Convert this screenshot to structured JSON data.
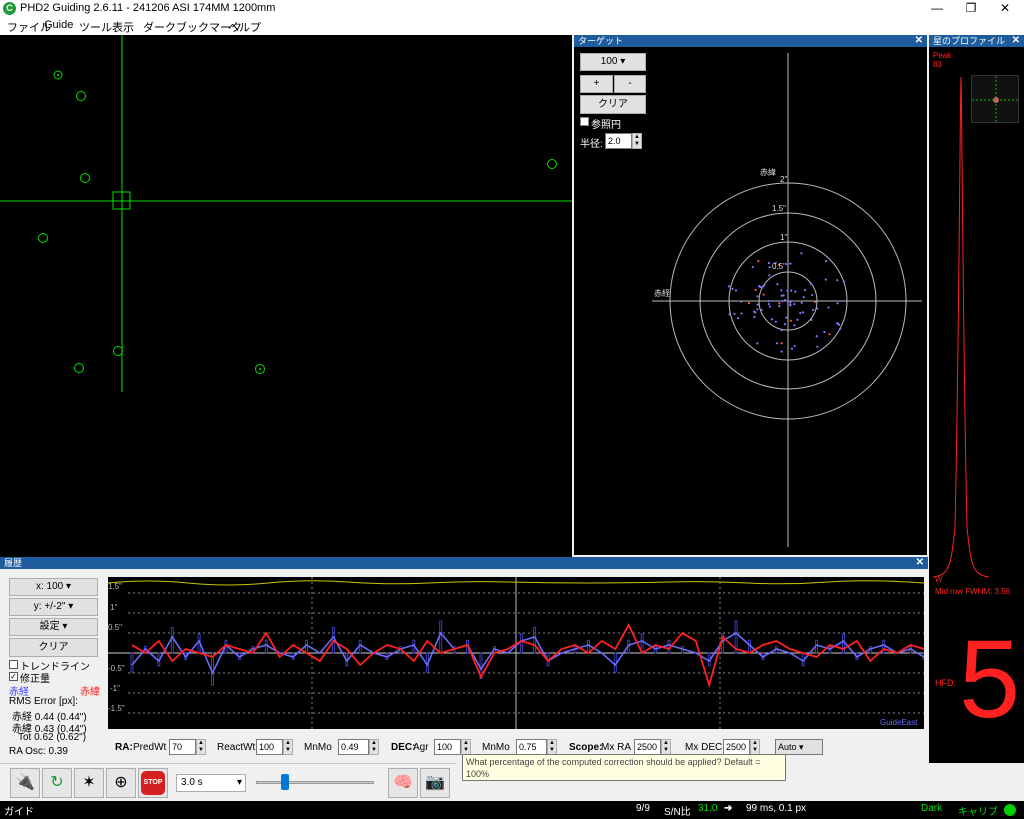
{
  "window": {
    "title": "PHD2 Guiding 2.6.11 - 241206 ASI 174MM  1200mm",
    "icon": "app-logo-icon",
    "buttons": {
      "minimize": "—",
      "maximize": "❐",
      "close": "✕"
    }
  },
  "menu": [
    "ファイル",
    "Guide",
    "ツール",
    "表示",
    "ダーク",
    "ブックマーク",
    "ヘルプ"
  ],
  "target": {
    "title": "ターゲット",
    "close": "✕",
    "zoom": "100",
    "plus": "+",
    "minus": "-",
    "clear": "クリア",
    "ref_circle": "参照円",
    "radius_label": "半径:",
    "radius_value": "2.0",
    "dec_label": "赤緯",
    "ra_label": "赤経",
    "ring_labels": [
      "2\"",
      "1.5\"",
      "1\"",
      "0.5\""
    ]
  },
  "profile": {
    "title": "星のプロファイル",
    "close": "✕",
    "peak_label": "Peak",
    "peak_value": "83",
    "w_label": "W",
    "midrow": "Mid row FWHM: 3.56",
    "hfd_label": "HFD:",
    "hfd_value": "5"
  },
  "history": {
    "title": "履歴",
    "close": "✕",
    "x_scale": "x: 100",
    "y_scale": "y: +/-2\"",
    "settings": "設定",
    "clear": "クリア",
    "trendline": "トレンドライン",
    "corrections": "修正量",
    "corrections_checked": true,
    "trendline_checked": false,
    "ra_legend": "赤経",
    "dec_legend": "赤緯",
    "rms_title": "RMS Error [px]:",
    "rms_ra": "赤経 0.44 (0.44\")",
    "rms_dec": "赤緯 0.43 (0.44\")",
    "rms_tot": "Tot 0.62 (0.62\")",
    "ra_osc": "RA Osc: 0.39",
    "y_ticks": [
      "1.5\"",
      "1\"",
      "0.5\"",
      "-0.5\"",
      "-1\"",
      "-1.5\""
    ],
    "algo_label": "GuideEast"
  },
  "params": {
    "ra_label": "RA:",
    "predwt_label": "PredWt",
    "predwt": "70",
    "reactwt_label": "ReactWt",
    "reactwt": "100",
    "mnmo_label": "MnMo",
    "mnmo_ra": "0.49",
    "dec_label": "DEC:",
    "agr_label": "Agr",
    "agr": "100",
    "mnmo_dec": "0.75",
    "scope_label": "Scope:",
    "mxra_label": "Mx RA",
    "mxra": "2500",
    "mxdec_label": "Mx DEC",
    "mxdec": "2500",
    "mode": "Auto"
  },
  "tooltip": "What percentage of the computed correction should be applied? Default = 100%",
  "toolbar": {
    "exposure": "3.0 s",
    "icons": [
      "usb-plug-icon",
      "loop-icon",
      "auto-select-star-icon",
      "guide-crosshair-icon",
      "stop-icon",
      "brain-icon",
      "camera-settings-icon"
    ],
    "stop_label": "STOP"
  },
  "status": {
    "mode": "ガイド",
    "frames": "9/9",
    "snr_label": "S/N比",
    "snr": "31.0",
    "timing": "99 ms, 0.1 px",
    "dark": "Dark",
    "calib": "キャリブ"
  },
  "colors": {
    "guide_green": "#00e000",
    "ra_blue": "#6a6aff",
    "dec_red": "#ff2020",
    "snr_yellow": "#c8c800",
    "pane_blue": "#1e5c9e"
  },
  "chart_data": {
    "type": "line",
    "ylim": [
      -2,
      2
    ],
    "series": [
      {
        "name": "赤経",
        "values": [
          -0.3,
          0.1,
          -0.2,
          0.4,
          -0.1,
          0.3,
          -0.5,
          0.2,
          -0.1,
          0.1,
          0.2,
          0.0,
          -0.1,
          0.2,
          0.0,
          0.4,
          -0.2,
          0.2,
          0.0,
          -0.1,
          0.1,
          0.2,
          -0.3,
          0.5,
          0.1,
          0.2,
          -0.4,
          0.1,
          0.0,
          0.3,
          0.4,
          -0.2,
          0.0,
          0.1,
          0.2,
          0.0,
          -0.3,
          0.2,
          0.3,
          0.1,
          0.2,
          0.1,
          0.0,
          -0.2,
          0.3,
          0.5,
          0.2,
          -0.1,
          0.1,
          0.0,
          -0.2,
          0.2,
          0.1,
          0.3,
          -0.1,
          0.1,
          0.2,
          0.0,
          0.1,
          -0.1
        ]
      },
      {
        "name": "赤緯",
        "values": [
          0.2,
          0.0,
          0.3,
          -0.2,
          0.1,
          0.0,
          -0.1,
          0.2,
          0.1,
          0.0,
          0.5,
          -0.1,
          0.2,
          0.0,
          -0.2,
          0.3,
          0.1,
          -0.3,
          0.0,
          0.2,
          0.1,
          -0.2,
          0.3,
          0.0,
          0.1,
          0.2,
          -0.6,
          0.0,
          0.1,
          0.3,
          0.2,
          -0.2,
          0.1,
          0.2,
          0.0,
          0.3,
          0.1,
          0.7,
          0.0,
          0.2,
          0.1,
          0.5,
          0.3,
          -0.8,
          0.4,
          0.1,
          0.0,
          0.2,
          0.3,
          0.1,
          0.0,
          -0.1,
          0.2,
          0.1,
          0.3,
          -0.2,
          0.1,
          0.0,
          0.2,
          0.1
        ]
      }
    ]
  }
}
